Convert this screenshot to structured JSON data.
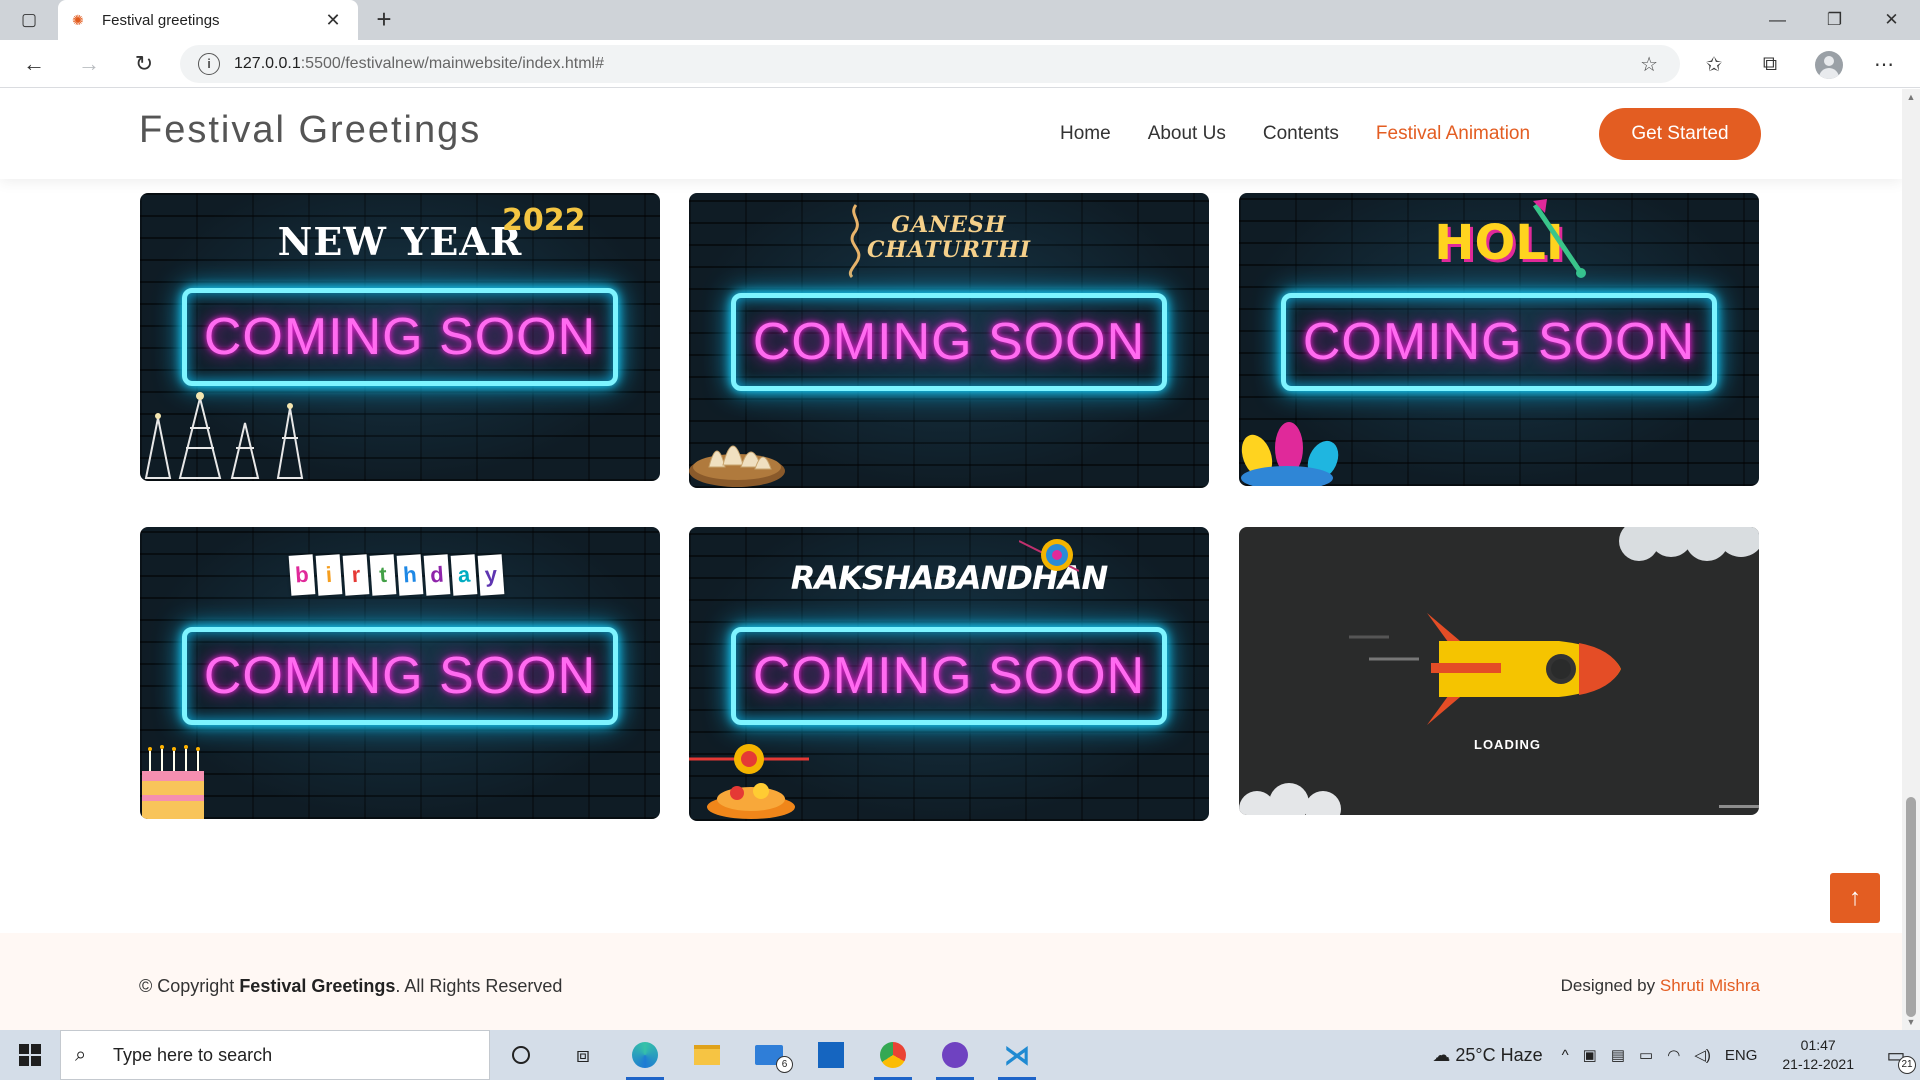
{
  "browser": {
    "tab_title": "Festival greetings",
    "url_host": "127.0.0.1",
    "url_rest": ":5500/festivalnew/mainwebsite/index.html#"
  },
  "site": {
    "brand": "Festival Greetings",
    "nav": [
      {
        "label": "Home",
        "active": false
      },
      {
        "label": "About Us",
        "active": false
      },
      {
        "label": "Contents",
        "active": false
      },
      {
        "label": "Festival Animation",
        "active": true
      }
    ],
    "cta": "Get Started",
    "accent": "#e35d22"
  },
  "cards": {
    "new_year": {
      "title": "NEW YEAR",
      "year": "2022",
      "sign": "COMING SOON"
    },
    "ganesh": {
      "title_line1": "GANESH",
      "title_line2": "CHATURTHI",
      "sign": "COMING SOON"
    },
    "holi": {
      "title": "HOLI",
      "sign": "COMING SOON"
    },
    "birthday": {
      "letters": [
        "b",
        "i",
        "r",
        "t",
        "h",
        "d",
        "a",
        "y"
      ],
      "sign": "COMING SOON"
    },
    "raksha": {
      "title": "RAKSHABANDHAN",
      "sign": "COMING SOON"
    },
    "rocket": {
      "status": "LOADING"
    }
  },
  "footer": {
    "copyright_prefix": "© Copyright ",
    "copyright_brand": "Festival Greetings",
    "copyright_suffix": ". All Rights Reserved",
    "designed_prefix": "Designed by ",
    "designer": "Shruti Mishra"
  },
  "taskbar": {
    "search_placeholder": "Type here to search",
    "mail_badge": "6",
    "weather": "25°C  Haze",
    "lang": "ENG",
    "time": "01:47",
    "date": "21-12-2021",
    "notifications": "21"
  }
}
